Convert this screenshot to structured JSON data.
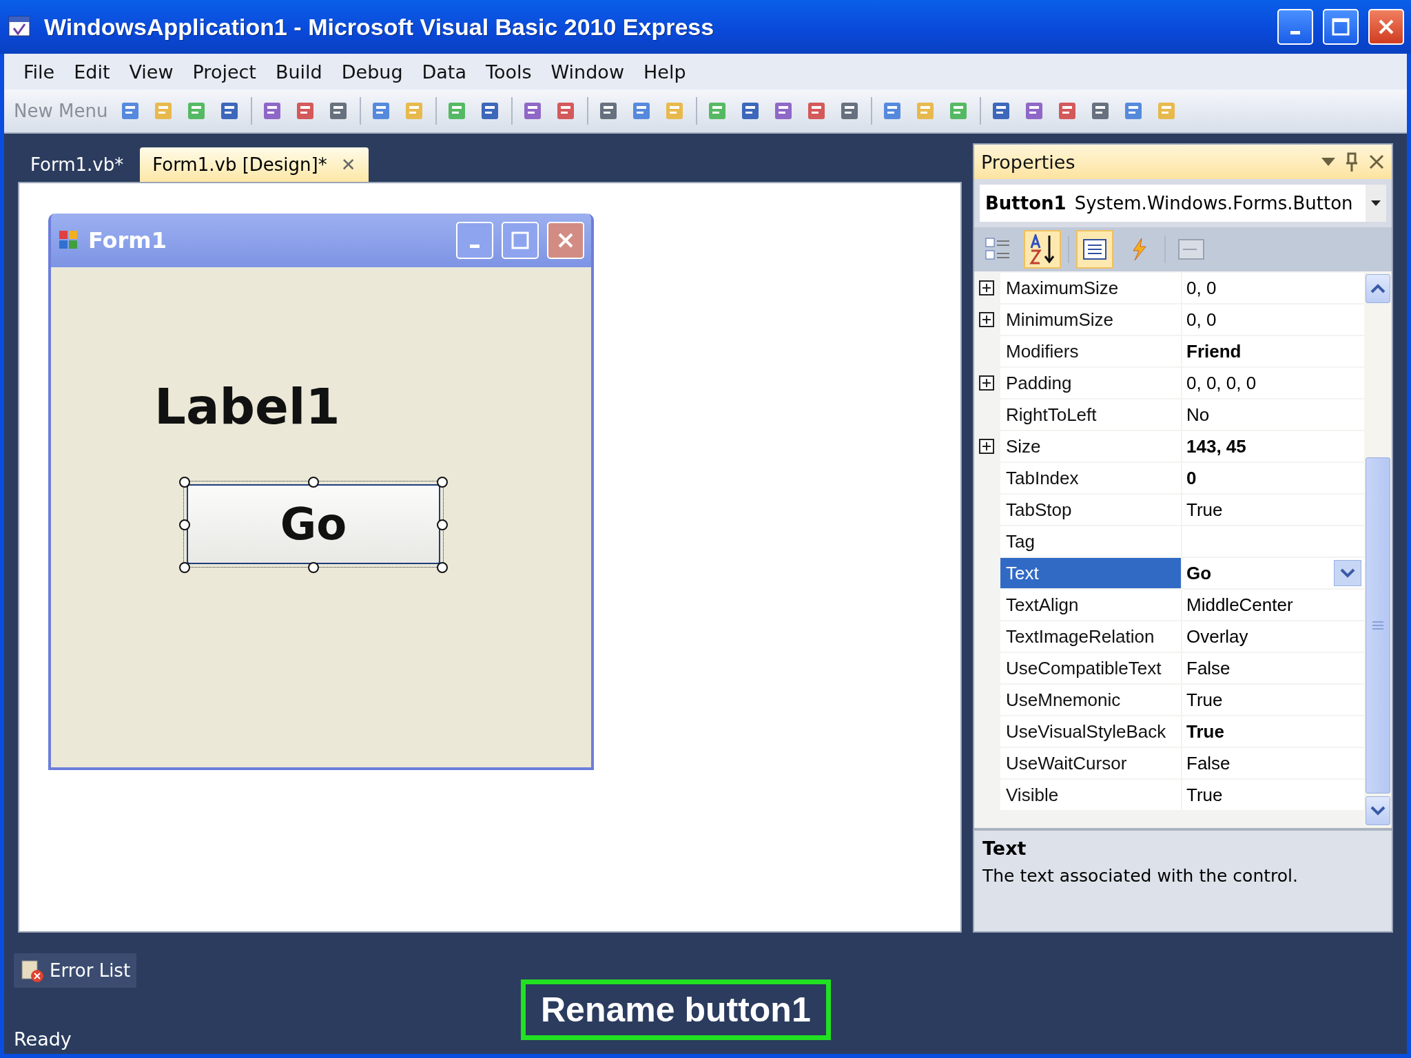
{
  "window": {
    "title": "WindowsApplication1 - Microsoft Visual Basic 2010 Express"
  },
  "menu": [
    "File",
    "Edit",
    "View",
    "Project",
    "Build",
    "Debug",
    "Data",
    "Tools",
    "Window",
    "Help"
  ],
  "toolbar": {
    "new_menu": "New Menu"
  },
  "tabs": [
    {
      "label": "Form1.vb*",
      "selected": false
    },
    {
      "label": "Form1.vb [Design]*",
      "selected": true,
      "close": "✕"
    }
  ],
  "designer": {
    "form_title": "Form1",
    "label": "Label1",
    "button": {
      "text": "Go",
      "selected": true
    }
  },
  "properties": {
    "title": "Properties",
    "object_name": "Button1",
    "object_type": "System.Windows.Forms.Button",
    "rows": [
      {
        "name": "MaximumSize",
        "value": "0, 0",
        "expandable": true,
        "bold": false,
        "selected": false
      },
      {
        "name": "MinimumSize",
        "value": "0, 0",
        "expandable": true,
        "bold": false,
        "selected": false
      },
      {
        "name": "Modifiers",
        "value": "Friend",
        "expandable": false,
        "bold": true,
        "selected": false
      },
      {
        "name": "Padding",
        "value": "0, 0, 0, 0",
        "expandable": true,
        "bold": false,
        "selected": false
      },
      {
        "name": "RightToLeft",
        "value": "No",
        "expandable": false,
        "bold": false,
        "selected": false
      },
      {
        "name": "Size",
        "value": "143, 45",
        "expandable": true,
        "bold": true,
        "selected": false
      },
      {
        "name": "TabIndex",
        "value": "0",
        "expandable": false,
        "bold": true,
        "selected": false
      },
      {
        "name": "TabStop",
        "value": "True",
        "expandable": false,
        "bold": false,
        "selected": false
      },
      {
        "name": "Tag",
        "value": "",
        "expandable": false,
        "bold": false,
        "selected": false
      },
      {
        "name": "Text",
        "value": "Go",
        "expandable": false,
        "bold": true,
        "selected": true
      },
      {
        "name": "TextAlign",
        "value": "MiddleCenter",
        "expandable": false,
        "bold": false,
        "selected": false
      },
      {
        "name": "TextImageRelation",
        "value": "Overlay",
        "expandable": false,
        "bold": false,
        "selected": false
      },
      {
        "name": "UseCompatibleText",
        "value": "False",
        "expandable": false,
        "bold": false,
        "selected": false
      },
      {
        "name": "UseMnemonic",
        "value": "True",
        "expandable": false,
        "bold": false,
        "selected": false
      },
      {
        "name": "UseVisualStyleBack",
        "value": "True",
        "expandable": false,
        "bold": true,
        "selected": false
      },
      {
        "name": "UseWaitCursor",
        "value": "False",
        "expandable": false,
        "bold": false,
        "selected": false
      },
      {
        "name": "Visible",
        "value": "True",
        "expandable": false,
        "bold": false,
        "selected": false
      }
    ],
    "description": {
      "title": "Text",
      "body": "The text associated with the control."
    }
  },
  "error_list": "Error List",
  "status_bar": "Ready",
  "caption": "Rename button1"
}
